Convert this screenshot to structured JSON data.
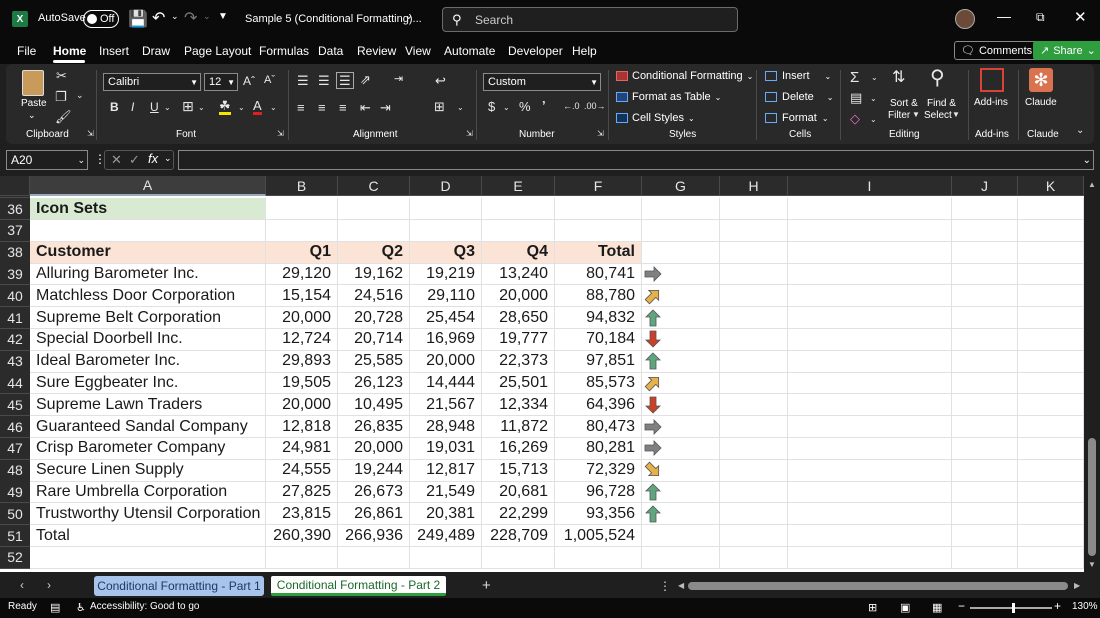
{
  "titlebar": {
    "autosave_label": "AutoSave",
    "autosave_state": "Off",
    "document_title": "Sample 5 (Conditional Formatting)...",
    "search_placeholder": "Search"
  },
  "menu": {
    "tabs": [
      "File",
      "Home",
      "Insert",
      "Draw",
      "Page Layout",
      "Formulas",
      "Data",
      "Review",
      "View",
      "Automate",
      "Developer",
      "Help"
    ],
    "active": "Home",
    "comments_label": "Comments",
    "share_label": "Share"
  },
  "ribbon": {
    "paste_label": "Paste",
    "font_name": "Calibri",
    "font_size": "12",
    "number_format": "Custom",
    "conditional_formatting": "Conditional Formatting",
    "format_as_table": "Format as Table",
    "cell_styles": "Cell Styles",
    "insert": "Insert",
    "delete": "Delete",
    "format": "Format",
    "sort_filter_1": "Sort &",
    "sort_filter_2": "Filter",
    "find_select_1": "Find &",
    "find_select_2": "Select",
    "addins": "Add-ins",
    "claude": "Claude",
    "groups": {
      "clipboard": "Clipboard",
      "font": "Font",
      "alignment": "Alignment",
      "number": "Number",
      "styles": "Styles",
      "cells": "Cells",
      "editing": "Editing",
      "addins": "Add-ins",
      "claude": "Claude"
    }
  },
  "formula_bar": {
    "name_box": "A20",
    "formula": ""
  },
  "grid": {
    "columns": [
      "A",
      "B",
      "C",
      "D",
      "E",
      "F",
      "G",
      "H",
      "I",
      "J",
      "K"
    ],
    "selected_column": "A",
    "section_title": "Icon Sets",
    "header_row": {
      "customer": "Customer",
      "q1": "Q1",
      "q2": "Q2",
      "q3": "Q3",
      "q4": "Q4",
      "total": "Total"
    },
    "rows": [
      {
        "row": "39",
        "customer": "Alluring Barometer Inc.",
        "q1": "29,120",
        "q2": "19,162",
        "q3": "19,219",
        "q4": "13,240",
        "total": "80,741",
        "icon": "arrow-right"
      },
      {
        "row": "40",
        "customer": "Matchless Door Corporation",
        "q1": "15,154",
        "q2": "24,516",
        "q3": "29,110",
        "q4": "20,000",
        "total": "88,780",
        "icon": "arrow-up-right"
      },
      {
        "row": "41",
        "customer": "Supreme Belt Corporation",
        "q1": "20,000",
        "q2": "20,728",
        "q3": "25,454",
        "q4": "28,650",
        "total": "94,832",
        "icon": "arrow-up"
      },
      {
        "row": "42",
        "customer": "Special Doorbell Inc.",
        "q1": "12,724",
        "q2": "20,714",
        "q3": "16,969",
        "q4": "19,777",
        "total": "70,184",
        "icon": "arrow-down"
      },
      {
        "row": "43",
        "customer": "Ideal Barometer Inc.",
        "q1": "29,893",
        "q2": "25,585",
        "q3": "20,000",
        "q4": "22,373",
        "total": "97,851",
        "icon": "arrow-up"
      },
      {
        "row": "44",
        "customer": "Sure Eggbeater Inc.",
        "q1": "19,505",
        "q2": "26,123",
        "q3": "14,444",
        "q4": "25,501",
        "total": "85,573",
        "icon": "arrow-up-right"
      },
      {
        "row": "45",
        "customer": "Supreme Lawn Traders",
        "q1": "20,000",
        "q2": "10,495",
        "q3": "21,567",
        "q4": "12,334",
        "total": "64,396",
        "icon": "arrow-down"
      },
      {
        "row": "46",
        "customer": "Guaranteed Sandal Company",
        "q1": "12,818",
        "q2": "26,835",
        "q3": "28,948",
        "q4": "11,872",
        "total": "80,473",
        "icon": "arrow-right"
      },
      {
        "row": "47",
        "customer": "Crisp Barometer Company",
        "q1": "24,981",
        "q2": "20,000",
        "q3": "19,031",
        "q4": "16,269",
        "total": "80,281",
        "icon": "arrow-right"
      },
      {
        "row": "48",
        "customer": "Secure Linen Supply",
        "q1": "24,555",
        "q2": "19,244",
        "q3": "12,817",
        "q4": "15,713",
        "total": "72,329",
        "icon": "arrow-down-right"
      },
      {
        "row": "49",
        "customer": "Rare Umbrella Corporation",
        "q1": "27,825",
        "q2": "26,673",
        "q3": "21,549",
        "q4": "20,681",
        "total": "96,728",
        "icon": "arrow-up"
      },
      {
        "row": "50",
        "customer": "Trustworthy Utensil Corporation",
        "q1": "23,815",
        "q2": "26,861",
        "q3": "20,381",
        "q4": "22,299",
        "total": "93,356",
        "icon": "arrow-up"
      }
    ],
    "total_row": {
      "row": "51",
      "customer": "Total",
      "q1": "260,390",
      "q2": "266,936",
      "q3": "249,489",
      "q4": "228,709",
      "total": "1,005,524"
    },
    "row_numbers_top": [
      "36",
      "37",
      "38"
    ],
    "row_number_last": "52"
  },
  "sheets": {
    "tabs": [
      "Conditional Formatting - Part 1",
      "Conditional Formatting - Part 2"
    ],
    "active": "Conditional Formatting - Part 2"
  },
  "status": {
    "ready": "Ready",
    "accessibility": "Accessibility: Good to go",
    "zoom": "130%"
  },
  "colors": {
    "header_fill": "#fbe3d6",
    "title_fill": "#d9ead3",
    "arrow_up": "#5fa67f",
    "arrow_down": "#c8412a",
    "arrow_side": "#808080",
    "arrow_diag": "#e6b04a",
    "share_green": "#2e9e3e"
  }
}
